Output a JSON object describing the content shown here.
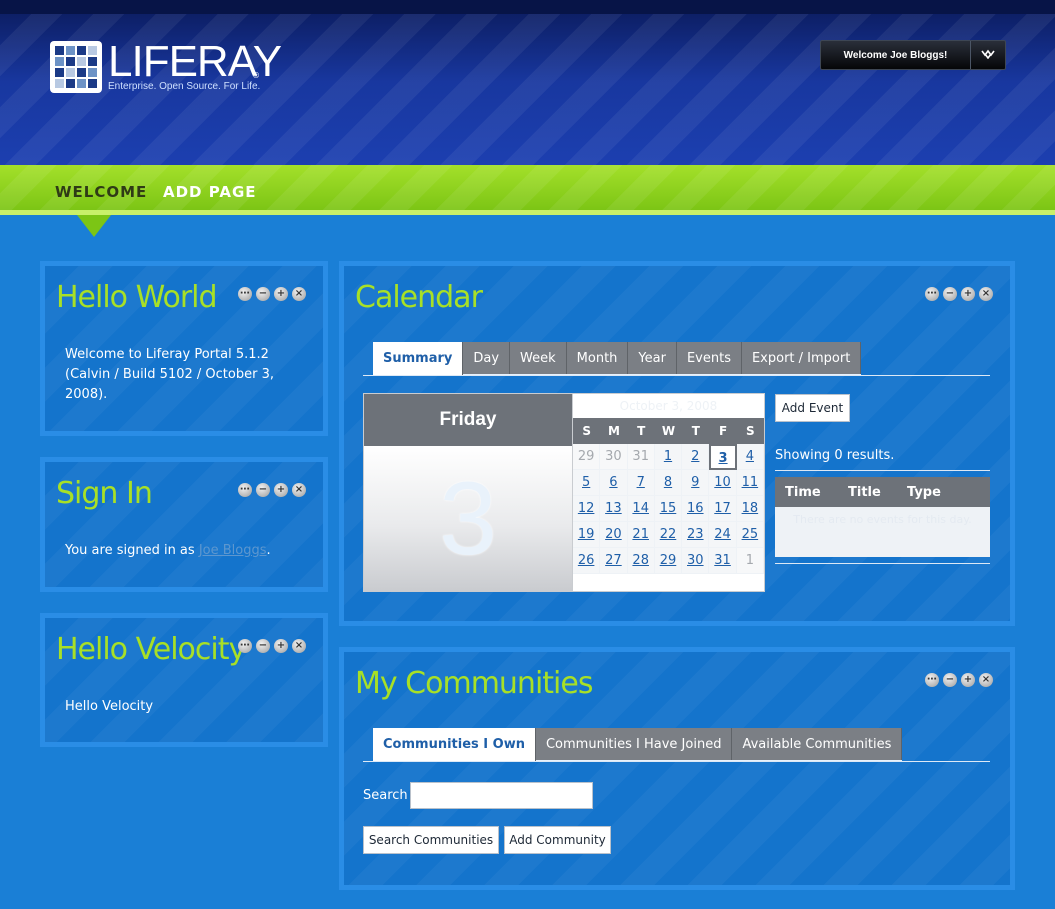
{
  "header": {
    "logo_text": "LIFERAY",
    "logo_reg": "®",
    "tagline": "Enterprise. Open Source. For Life.",
    "user_greeting": "Welcome Joe Bloggs!"
  },
  "nav": {
    "items": [
      {
        "label": "WELCOME"
      },
      {
        "label": "ADD PAGE"
      }
    ]
  },
  "portlets": {
    "hello_world": {
      "title": "Hello World",
      "text": "Welcome to Liferay Portal 5.1.2 (Calvin / Build 5102 / October 3, 2008)."
    },
    "sign_in": {
      "title": "Sign In",
      "text_prefix": "You are signed in as",
      "user_link": "Joe Bloggs",
      "text_suffix": "."
    },
    "hello_velocity": {
      "title": "Hello Velocity",
      "text": "Hello Velocity"
    },
    "calendar": {
      "title": "Calendar",
      "tabs": [
        "Summary",
        "Day",
        "Week",
        "Month",
        "Year",
        "Events",
        "Export / Import"
      ],
      "active_tab": "Summary",
      "day_name": "Friday",
      "day_number": "3",
      "month_header": "October 3, 2008",
      "dow": [
        "S",
        "M",
        "T",
        "W",
        "T",
        "F",
        "S"
      ],
      "weeks": [
        [
          "29",
          "30",
          "31",
          "1",
          "2",
          "3",
          "4"
        ],
        [
          "5",
          "6",
          "7",
          "8",
          "9",
          "10",
          "11"
        ],
        [
          "12",
          "13",
          "14",
          "15",
          "16",
          "17",
          "18"
        ],
        [
          "19",
          "20",
          "21",
          "22",
          "23",
          "24",
          "25"
        ],
        [
          "26",
          "27",
          "28",
          "29",
          "30",
          "31",
          "1"
        ]
      ],
      "add_event_label": "Add Event",
      "showing": "Showing 0 results.",
      "columns": [
        "Time",
        "Title",
        "Type"
      ],
      "empty_message": "There are no events for this day."
    },
    "communities": {
      "title": "My Communities",
      "tabs": [
        "Communities I Own",
        "Communities I Have Joined",
        "Available Communities"
      ],
      "active_tab": "Communities I Own",
      "search_label": "Search",
      "search_value": "",
      "search_button": "Search Communities",
      "add_button": "Add Community"
    }
  },
  "colors": {
    "page_bg": "#1a7fd6",
    "header_bg": "#18379f",
    "nav_bg": "#8fd21f",
    "portlet_title": "#a8e026",
    "tab_bg": "#7b7f85"
  },
  "icons": {
    "portlet_controls": [
      "options-icon",
      "minimize-icon",
      "maximize-icon",
      "close-icon"
    ],
    "portlet_control_glyphs": [
      "⋯",
      "−",
      "+",
      "×"
    ]
  }
}
